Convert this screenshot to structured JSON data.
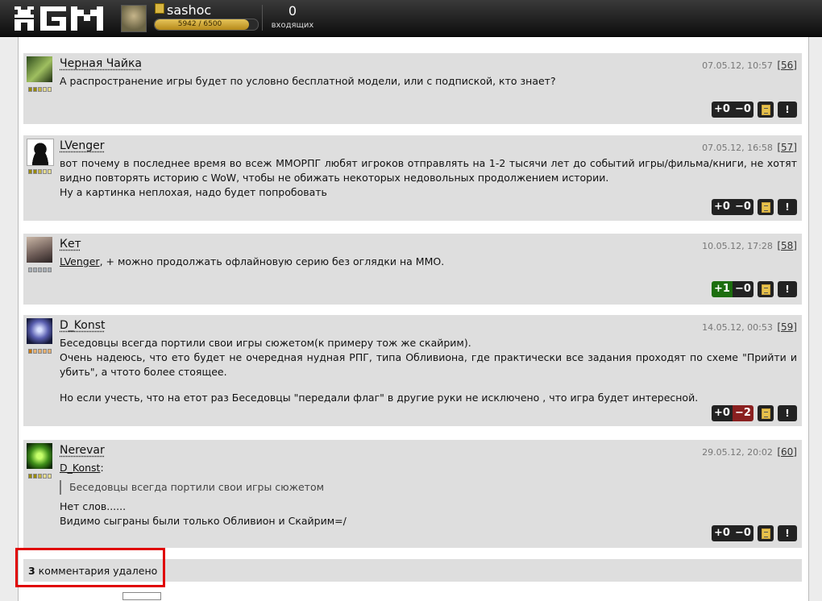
{
  "header": {
    "logo_text": "MGM",
    "username": "sashoc",
    "xp_text": "5942 / 6500",
    "xp_fraction": 0.914,
    "incoming_count": "0",
    "incoming_label": "входящих"
  },
  "comments": [
    {
      "author": "Черная Чайка",
      "date": "07.05.12, 10:57",
      "num": "[56]",
      "rank": "yellow",
      "lines": [
        "А распространение игры будет по условно бесплатной модели, или с подпиской, кто знает?"
      ],
      "plus": "+0",
      "minus": "−0"
    },
    {
      "author": "LVenger",
      "date": "07.05.12, 16:58",
      "num": "[57]",
      "rank": "yellow",
      "lines": [
        "вот почему в последнее время во всеж ММОРПГ любят игроков отправлять на 1-2 тысячи лет до событий игры/фильма/книги, не хотят видно повторять историю с WoW, чтобы не обижать некоторых недовольных продолжением истории.",
        "Ну а картинка неплохая, надо будет попробовать"
      ],
      "plus": "+0",
      "minus": "−0"
    },
    {
      "author": "Кет",
      "date": "10.05.12, 17:28",
      "num": "[58]",
      "rank": "grey",
      "reply_to": "LVenger",
      "lines": [
        ", + можно продолжать офлайновую серию без оглядки на ММО."
      ],
      "plus": "+1",
      "minus": "−0"
    },
    {
      "author": "D_Konst",
      "date": "14.05.12, 00:53",
      "num": "[59]",
      "rank": "orange",
      "lines": [
        "Беседовцы всегда портили свои игры сюжетом(к примеру тож же скайрим).",
        "Очень надеюсь, что ето будет не очередная нудная РПГ, типа Обливиона, где практически все задания проходят по схеме \"Прийти и убить\", а чтото более стоящее.",
        "",
        "Но если учесть, что на етот раз Беседовцы \"передали флаг\" в другие руки не исключено , что игра будет интересной."
      ],
      "plus": "+0",
      "minus": "−2"
    },
    {
      "author": "Nerevar",
      "date": "29.05.12, 20:02",
      "num": "[60]",
      "rank": "yellow",
      "reply_to": "D_Konst",
      "quote": "Беседовцы всегда портили свои игры сюжетом",
      "lines": [
        "Нет слов......",
        "Видимо сыграны были только Обливион и Скайрим=/"
      ],
      "plus": "+0",
      "minus": "−0"
    }
  ],
  "deleted": {
    "count": "3",
    "text": " комментария удалено"
  },
  "colors": {
    "vote_plus_active": "#1d6e0f",
    "vote_minus_active": "#8a2020",
    "highlight": "#e00000"
  },
  "icons": {
    "report": "!",
    "quote": "quote-icon"
  }
}
